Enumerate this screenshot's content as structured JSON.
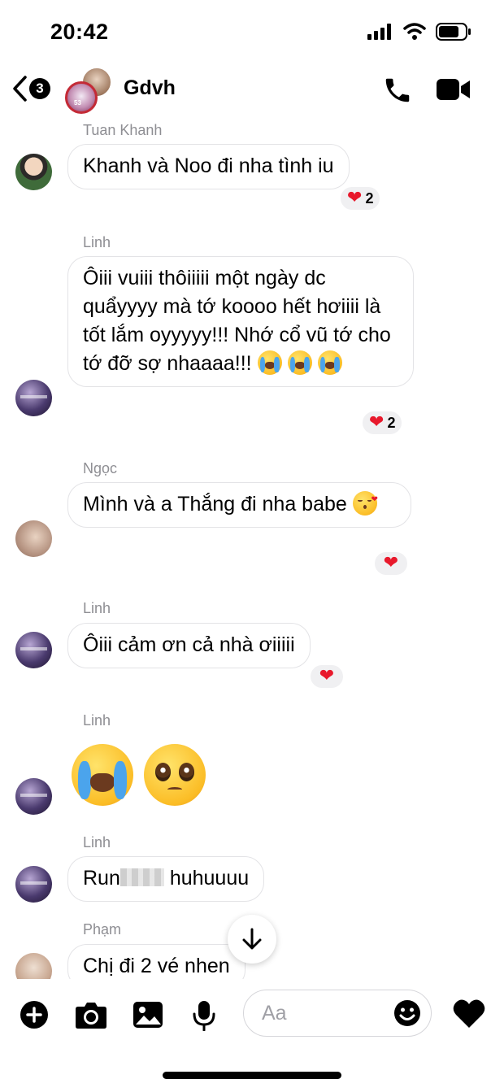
{
  "status_bar": {
    "time": "20:42"
  },
  "header": {
    "back_count": "3",
    "group_name": "Gdvh",
    "avatar_badge": "53"
  },
  "messages": [
    {
      "sender": "Tuan Khanh",
      "text": "Khanh và Noo đi nha tình iu",
      "reaction_count": "2"
    },
    {
      "sender": "Linh",
      "text": "Ôiii vuiii thôiiiii một ngày dc quẩyyyy mà tớ koooo hết hơiiii là tốt lắm oyyyyy!!! Nhớ cổ vũ tớ cho tớ đỡ sợ nhaaaa!!!",
      "reaction_count": "2"
    },
    {
      "sender": "Ngọc",
      "text": "Mình và a Thắng đi nha babe"
    },
    {
      "sender": "Linh",
      "text": "Ôiii cảm ơn cả nhà ơiiiii"
    },
    {
      "sender": "Linh"
    },
    {
      "sender": "Linh",
      "text_before": "Run",
      "text_after": " huhuuuu"
    },
    {
      "sender": "Phạm",
      "text": "Chị đi 2 vé nhen"
    }
  ],
  "composer": {
    "placeholder": "Aa"
  },
  "colors": {
    "reaction_heart": "#e8192c",
    "bubble_border": "#e3e3e6",
    "sender_gray": "#8e8e93"
  },
  "icons": [
    "back-chevron-icon",
    "phone-icon",
    "video-camera-icon",
    "plus-icon",
    "camera-icon",
    "image-icon",
    "microphone-icon",
    "emoji-icon",
    "heart-icon",
    "arrow-down-icon"
  ]
}
